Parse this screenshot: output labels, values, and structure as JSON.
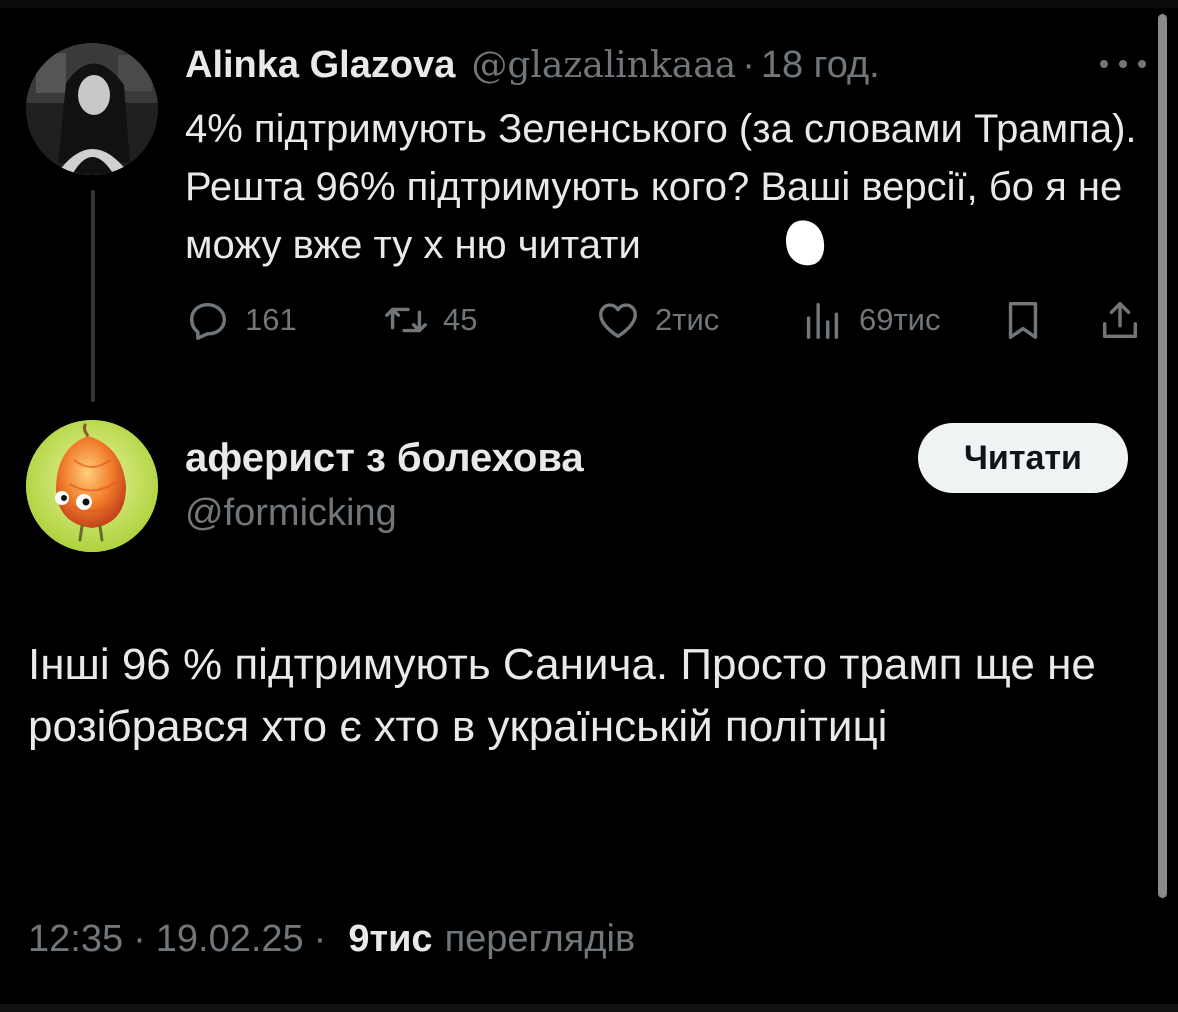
{
  "parent_tweet": {
    "author_name": "Alinka Glazova",
    "author_handle": "@glazalinkaaa",
    "separator": "·",
    "time": "18 год.",
    "text": "4% підтримують Зеленського (за словами Трампа). Решта 96% підтримують кого? Ваші версії, бо я не можу вже ту х       ню читати",
    "stats": {
      "replies": "161",
      "retweets": "45",
      "likes": "2тис",
      "views": "69тис"
    }
  },
  "main_tweet": {
    "author_name": "аферист з болехова",
    "author_handle": "@formicking",
    "follow_label": "Читати",
    "text": "Інші 96 % підтримують Санича. Просто трамп ще не розібрався хто є хто в українській політиці",
    "time": "12:35",
    "date": "19.02.25",
    "separator": "·",
    "views_count": "9тис",
    "views_label": "переглядів"
  },
  "icons": {
    "more": "more-horizontal-icon",
    "reply": "reply-icon",
    "retweet": "retweet-icon",
    "like": "heart-icon",
    "views": "views-bar-chart-icon",
    "bookmark": "bookmark-icon",
    "share": "share-icon"
  },
  "colors": {
    "background": "#000000",
    "text_primary": "#e7e9ea",
    "text_secondary": "#71767b",
    "button_bg": "#eff3f4"
  }
}
